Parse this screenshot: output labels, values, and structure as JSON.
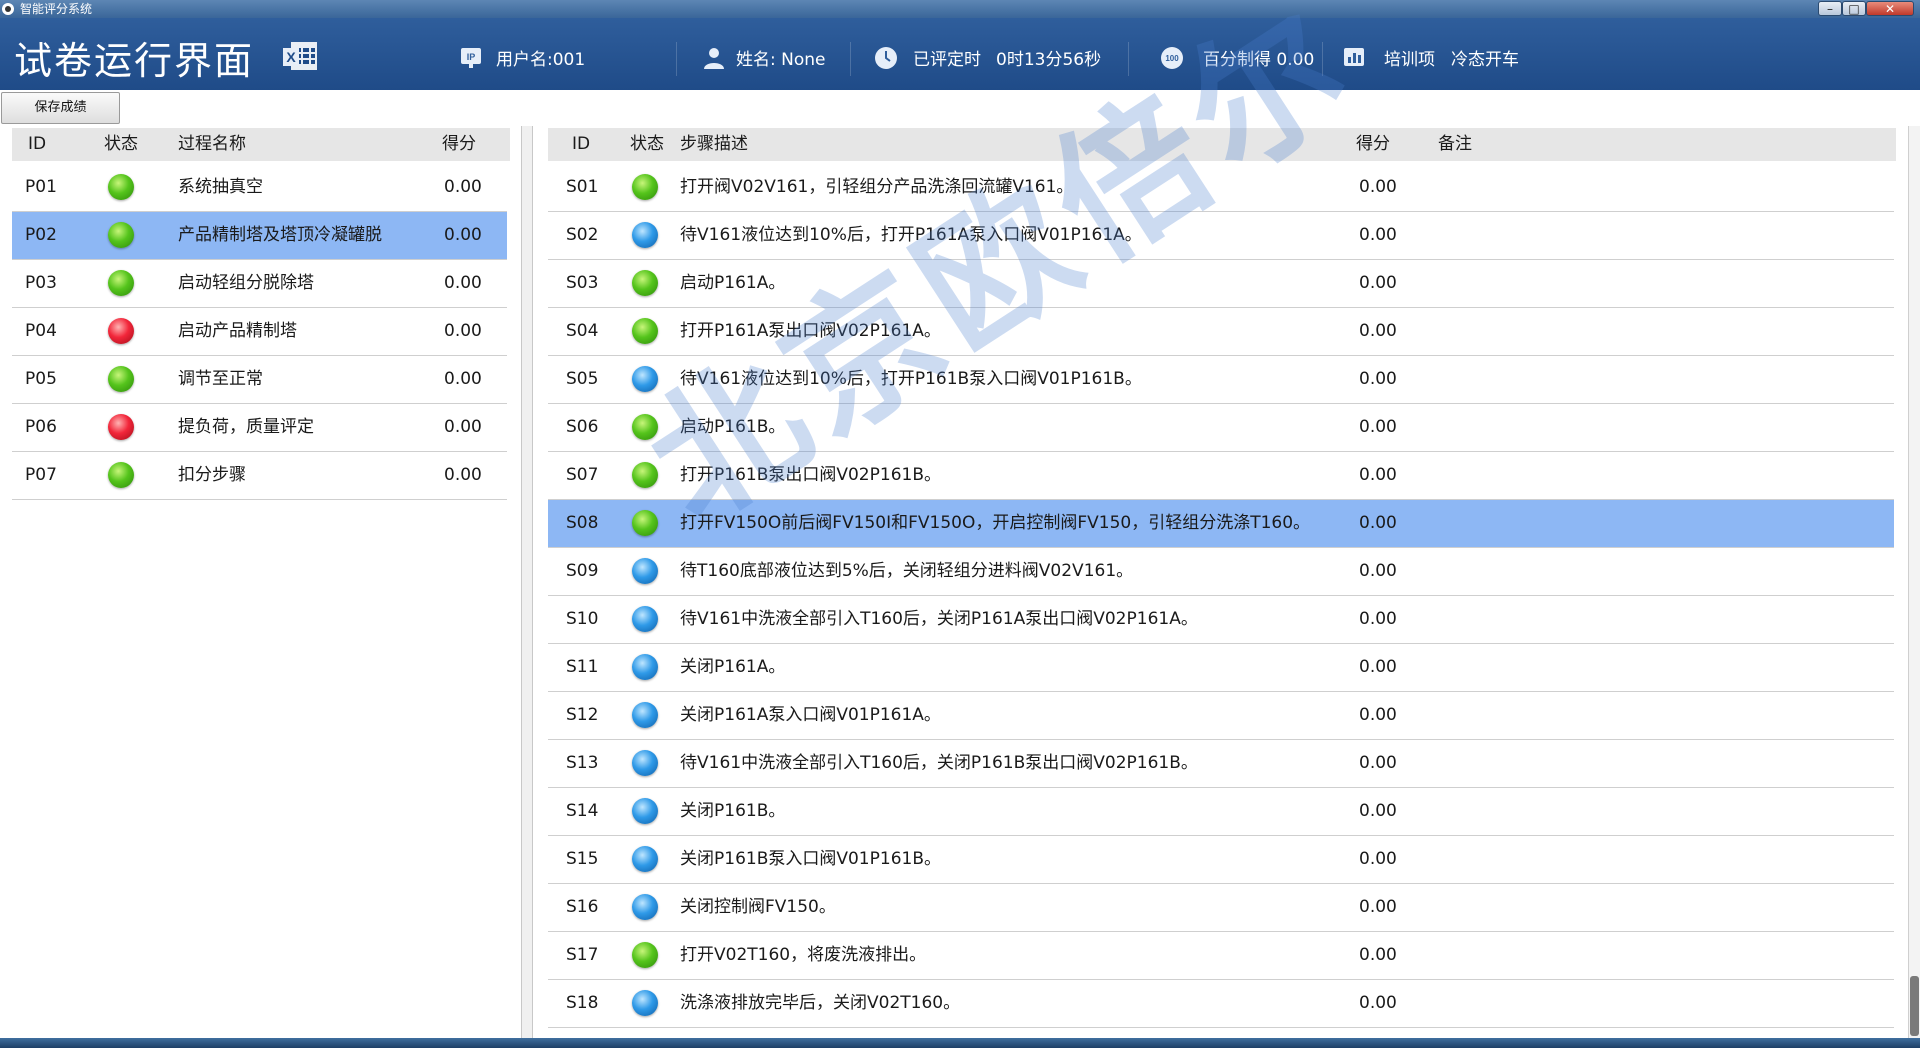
{
  "window": {
    "title": "智能评分系统"
  },
  "header": {
    "page_title": "试卷运行界面",
    "username": "用户名:001",
    "fullname": "姓名: None",
    "elapsed_label": "已评定时",
    "elapsed_value": "0时13分56秒",
    "score_text": "百分制得 0.00",
    "training_label": "培训项",
    "training_value": "冷态开车",
    "icons": [
      "ip-icon",
      "user-icon",
      "clock-icon",
      "score-100-icon",
      "chart-icon",
      "excel-icon"
    ]
  },
  "toolbar": {
    "save_label": "保存成绩"
  },
  "process_table": {
    "headers": {
      "id": "ID",
      "status": "状态",
      "name": "过程名称",
      "score": "得分"
    },
    "rows": [
      {
        "id": "P01",
        "status": "green",
        "name": "系统抽真空",
        "score": "0.00"
      },
      {
        "id": "P02",
        "status": "green",
        "name": "产品精制塔及塔顶冷凝罐脱",
        "score": "0.00",
        "selected": true
      },
      {
        "id": "P03",
        "status": "green",
        "name": "启动轻组分脱除塔",
        "score": "0.00"
      },
      {
        "id": "P04",
        "status": "red",
        "name": "启动产品精制塔",
        "score": "0.00"
      },
      {
        "id": "P05",
        "status": "green",
        "name": "调节至正常",
        "score": "0.00"
      },
      {
        "id": "P06",
        "status": "red",
        "name": "提负荷，质量评定",
        "score": "0.00"
      },
      {
        "id": "P07",
        "status": "green",
        "name": "扣分步骤",
        "score": "0.00"
      }
    ]
  },
  "step_table": {
    "headers": {
      "id": "ID",
      "status": "状态",
      "desc": "步骤描述",
      "score": "得分",
      "note": "备注"
    },
    "rows": [
      {
        "id": "S01",
        "status": "green",
        "desc": "打开阀V02V161，引轻组分产品洗涤回流罐V161。",
        "score": "0.00"
      },
      {
        "id": "S02",
        "status": "blue",
        "desc": "待V161液位达到10%后，打开P161A泵入口阀V01P161A。",
        "score": "0.00"
      },
      {
        "id": "S03",
        "status": "green",
        "desc": "启动P161A。",
        "score": "0.00"
      },
      {
        "id": "S04",
        "status": "green",
        "desc": "打开P161A泵出口阀V02P161A。",
        "score": "0.00"
      },
      {
        "id": "S05",
        "status": "blue",
        "desc": "待V161液位达到10%后，打开P161B泵入口阀V01P161B。",
        "score": "0.00"
      },
      {
        "id": "S06",
        "status": "green",
        "desc": "启动P161B。",
        "score": "0.00"
      },
      {
        "id": "S07",
        "status": "green",
        "desc": "打开P161B泵出口阀V02P161B。",
        "score": "0.00"
      },
      {
        "id": "S08",
        "status": "green",
        "desc": "打开FV150O前后阀FV150I和FV150O，开启控制阀FV150，引轻组分洗涤T160。",
        "score": "0.00",
        "selected": true
      },
      {
        "id": "S09",
        "status": "blue",
        "desc": "待T160底部液位达到5%后，关闭轻组分进料阀V02V161。",
        "score": "0.00"
      },
      {
        "id": "S10",
        "status": "blue",
        "desc": "待V161中洗液全部引入T160后，关闭P161A泵出口阀V02P161A。",
        "score": "0.00"
      },
      {
        "id": "S11",
        "status": "blue",
        "desc": "关闭P161A。",
        "score": "0.00"
      },
      {
        "id": "S12",
        "status": "blue",
        "desc": "关闭P161A泵入口阀V01P161A。",
        "score": "0.00"
      },
      {
        "id": "S13",
        "status": "blue",
        "desc": "待V161中洗液全部引入T160后，关闭P161B泵出口阀V02P161B。",
        "score": "0.00"
      },
      {
        "id": "S14",
        "status": "blue",
        "desc": "关闭P161B。",
        "score": "0.00"
      },
      {
        "id": "S15",
        "status": "blue",
        "desc": "关闭P161B泵入口阀V01P161B。",
        "score": "0.00"
      },
      {
        "id": "S16",
        "status": "blue",
        "desc": "关闭控制阀FV150。",
        "score": "0.00"
      },
      {
        "id": "S17",
        "status": "green",
        "desc": "打开V02T160，将废洗液排出。",
        "score": "0.00"
      },
      {
        "id": "S18",
        "status": "blue",
        "desc": "洗涤液排放完毕后，关闭V02T160。",
        "score": "0.00"
      }
    ]
  },
  "watermark": "北京欧倍尔",
  "colors": {
    "header": "#1f4b88",
    "selected_row": "#8db7f4",
    "green": "#55c41c",
    "red": "#f2263a",
    "blue": "#2f9ae8"
  }
}
